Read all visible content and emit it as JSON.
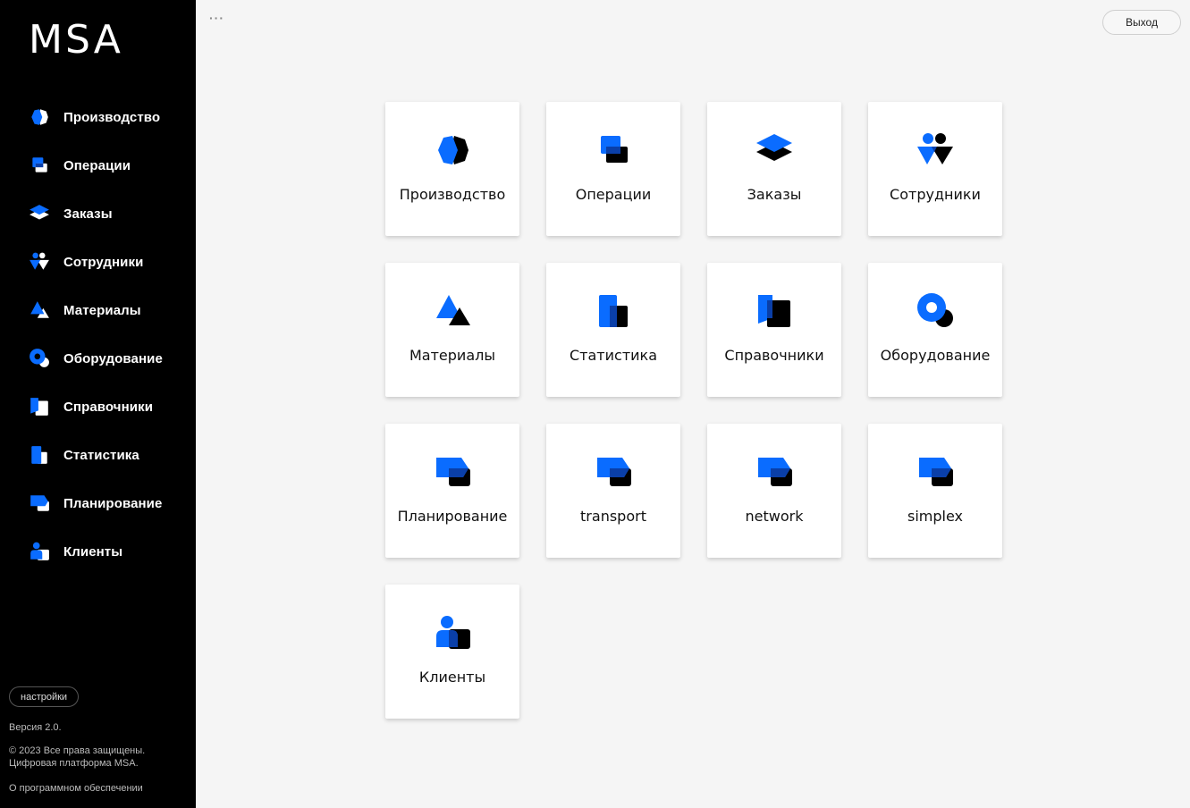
{
  "app": {
    "logo_text": "MSA"
  },
  "colors": {
    "accent": "#0a6cff",
    "sidebar_bg": "#000000",
    "page_bg": "#f5f5f5",
    "tile_bg": "#ffffff"
  },
  "sidebar": {
    "items": [
      {
        "label": "Производство",
        "icon": "production-icon"
      },
      {
        "label": "Операции",
        "icon": "operations-icon"
      },
      {
        "label": "Заказы",
        "icon": "orders-icon"
      },
      {
        "label": "Сотрудники",
        "icon": "employees-icon"
      },
      {
        "label": "Материалы",
        "icon": "materials-icon"
      },
      {
        "label": "Оборудование",
        "icon": "equipment-icon"
      },
      {
        "label": "Справочники",
        "icon": "references-icon"
      },
      {
        "label": "Статистика",
        "icon": "statistics-icon"
      },
      {
        "label": "Планирование",
        "icon": "planning-icon"
      },
      {
        "label": "Клиенты",
        "icon": "clients-icon"
      }
    ],
    "settings_label": "настройки",
    "version": "Версия 2.0.",
    "copyright_line1": "© 2023 Все права защищены.",
    "copyright_line2": "Цифровая платформа MSA.",
    "about_link": "О программном обеспечении"
  },
  "header": {
    "menu_dots": "···",
    "logout_label": "Выход"
  },
  "tiles": [
    {
      "label": "Производство",
      "icon": "production-icon"
    },
    {
      "label": "Операции",
      "icon": "operations-icon"
    },
    {
      "label": "Заказы",
      "icon": "orders-icon"
    },
    {
      "label": "Сотрудники",
      "icon": "employees-icon"
    },
    {
      "label": "Материалы",
      "icon": "materials-icon"
    },
    {
      "label": "Статистика",
      "icon": "statistics-icon"
    },
    {
      "label": "Справочники",
      "icon": "references-icon"
    },
    {
      "label": "Оборудование",
      "icon": "equipment-icon"
    },
    {
      "label": "Планирование",
      "icon": "planning-icon"
    },
    {
      "label": "transport",
      "icon": "planning-icon"
    },
    {
      "label": "network",
      "icon": "planning-icon"
    },
    {
      "label": "simplex",
      "icon": "planning-icon"
    },
    {
      "label": "Клиенты",
      "icon": "clients-icon"
    }
  ]
}
